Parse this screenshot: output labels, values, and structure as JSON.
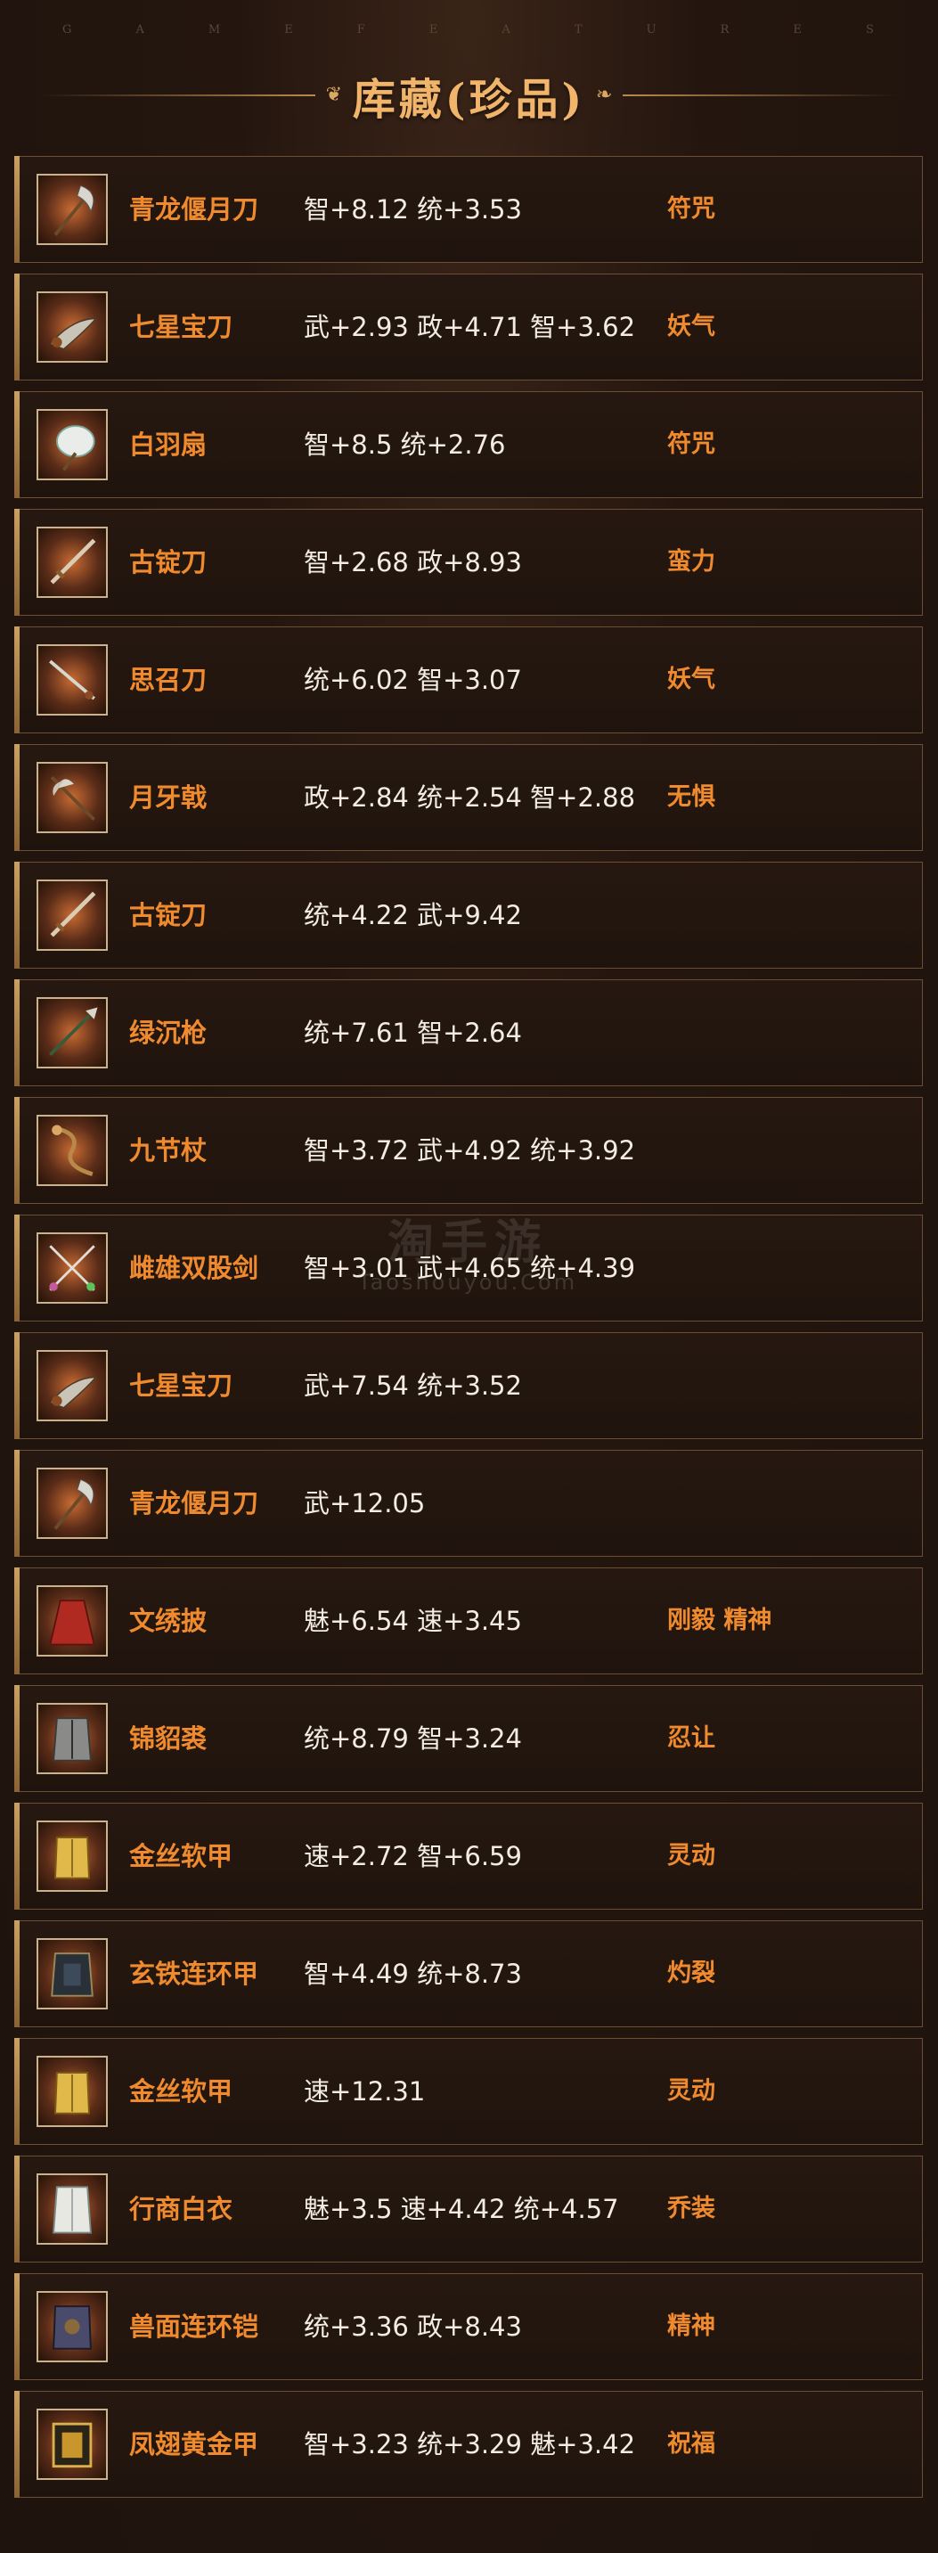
{
  "header": {
    "banner_letters": [
      "G",
      "A",
      "M",
      "E",
      "F",
      "E",
      "A",
      "T",
      "U",
      "R",
      "E",
      "S"
    ],
    "title": "库藏(珍品)"
  },
  "watermark": {
    "cn": "淘手游",
    "en": "Taoshouyou.Com"
  },
  "items": [
    {
      "name": "青龙偃月刀",
      "stats": "智+8.12 统+3.53",
      "trait": "符咒",
      "icon": "crescent-blade-icon"
    },
    {
      "name": "七星宝刀",
      "stats": "武+2.93 政+4.71 智+3.62",
      "trait": "妖气",
      "icon": "dragon-saber-icon"
    },
    {
      "name": "白羽扇",
      "stats": "智+8.5 统+2.76",
      "trait": "符咒",
      "icon": "feather-fan-icon"
    },
    {
      "name": "古锭刀",
      "stats": "智+2.68 政+8.93",
      "trait": "蛮力",
      "icon": "ancient-sword-icon"
    },
    {
      "name": "思召刀",
      "stats": "统+6.02 智+3.07",
      "trait": "妖气",
      "icon": "sword-icon"
    },
    {
      "name": "月牙戟",
      "stats": "政+2.84 统+2.54 智+2.88",
      "trait": "无惧",
      "icon": "halberd-icon"
    },
    {
      "name": "古锭刀",
      "stats": "统+4.22 武+9.42",
      "trait": "",
      "icon": "ancient-sword-icon"
    },
    {
      "name": "绿沉枪",
      "stats": "统+7.61 智+2.64",
      "trait": "",
      "icon": "spear-icon"
    },
    {
      "name": "九节杖",
      "stats": "智+3.72 武+4.92 统+3.92",
      "trait": "",
      "icon": "staff-icon"
    },
    {
      "name": "雌雄双股剑",
      "stats": "智+3.01 武+4.65 统+4.39",
      "trait": "",
      "icon": "twin-swords-icon"
    },
    {
      "name": "七星宝刀",
      "stats": "武+7.54 统+3.52",
      "trait": "",
      "icon": "dragon-saber-icon"
    },
    {
      "name": "青龙偃月刀",
      "stats": "武+12.05",
      "trait": "",
      "icon": "crescent-blade-icon"
    },
    {
      "name": "文绣披",
      "stats": "魅+6.54 速+3.45",
      "trait": "刚毅 精神",
      "icon": "cloak-icon"
    },
    {
      "name": "锦貂裘",
      "stats": "统+8.79 智+3.24",
      "trait": "忍让",
      "icon": "fur-robe-icon"
    },
    {
      "name": "金丝软甲",
      "stats": "速+2.72 智+6.59",
      "trait": "灵动",
      "icon": "gold-armor-icon"
    },
    {
      "name": "玄铁连环甲",
      "stats": "智+4.49 统+8.73",
      "trait": "灼裂",
      "icon": "iron-armor-icon"
    },
    {
      "name": "金丝软甲",
      "stats": "速+12.31",
      "trait": "灵动",
      "icon": "gold-armor-icon"
    },
    {
      "name": "行商白衣",
      "stats": "魅+3.5 速+4.42 统+4.57",
      "trait": "乔装",
      "icon": "white-robe-icon"
    },
    {
      "name": "兽面连环铠",
      "stats": "统+3.36 政+8.43",
      "trait": "精神",
      "icon": "beast-armor-icon"
    },
    {
      "name": "凤翅黄金甲",
      "stats": "智+3.23 统+3.29 魅+3.42",
      "trait": "祝福",
      "icon": "golden-armor-icon"
    }
  ]
}
